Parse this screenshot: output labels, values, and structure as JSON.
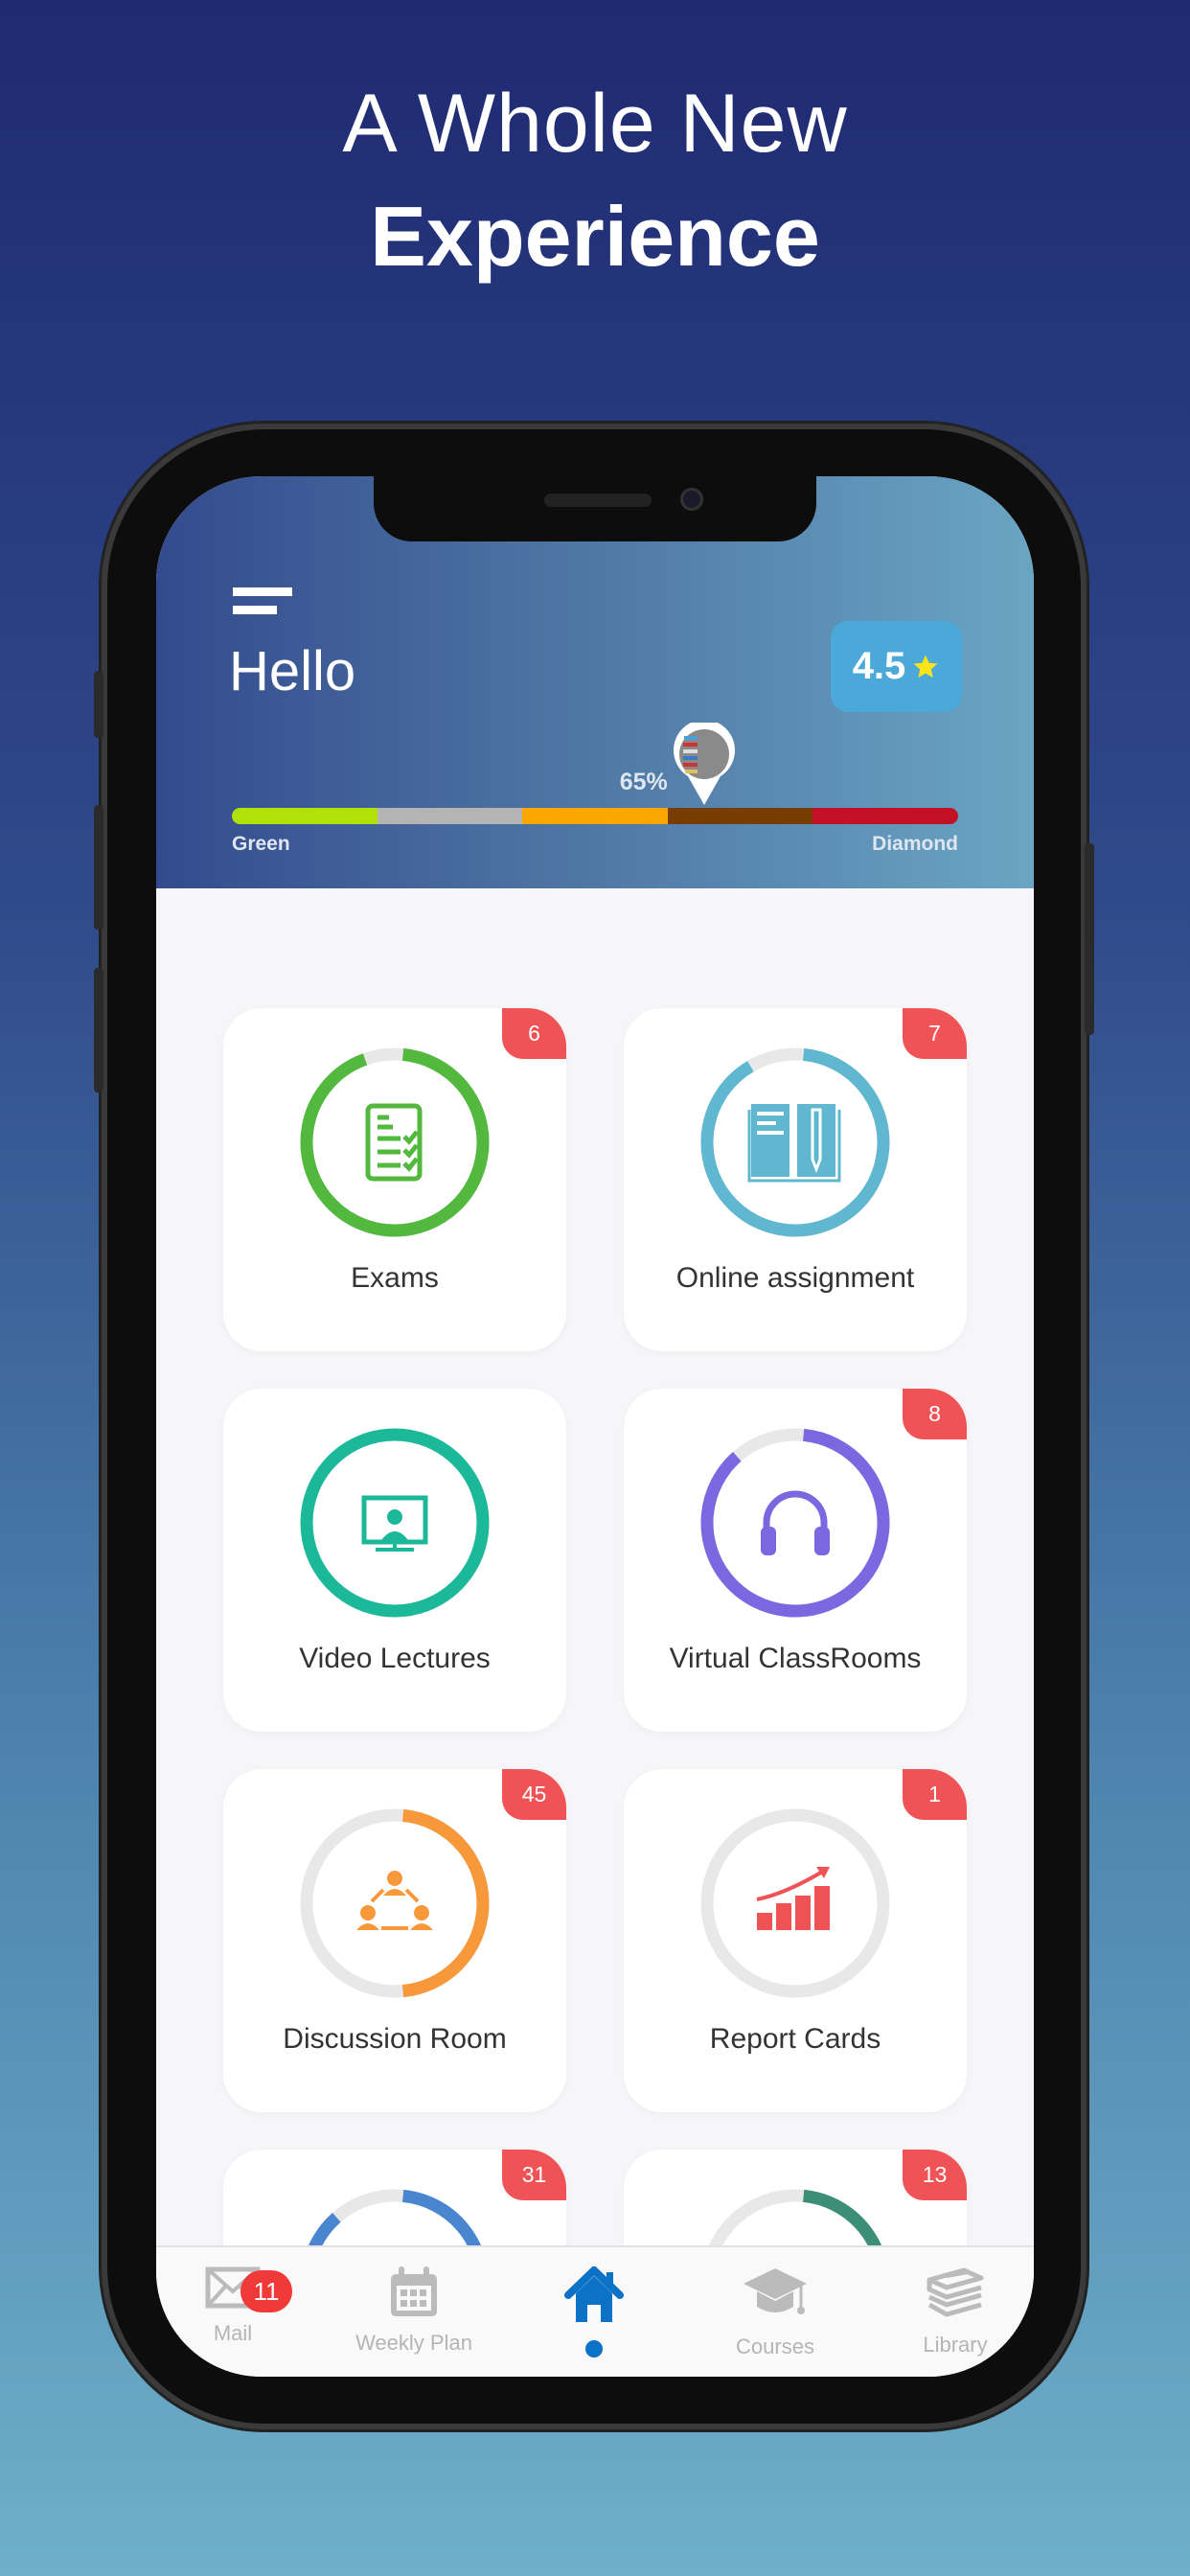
{
  "headline": {
    "line1": "A Whole New",
    "line2": "Experience"
  },
  "header": {
    "greeting": "Hello",
    "rating": "4.5",
    "rating_icon": "star-icon",
    "progress_label": "65%",
    "progress_value": 0.65,
    "levels": {
      "start": "Green",
      "end": "Diamond"
    },
    "level_colors": [
      "#b0e20a",
      "#b4b4b4",
      "#fca600",
      "#763c00",
      "#c21125"
    ]
  },
  "cards": [
    {
      "label": "Exams",
      "badge": "6",
      "color": "#52b83e",
      "progress": 0.96,
      "icon": "exam-checklist-icon"
    },
    {
      "label": "Online assignment",
      "badge": "7",
      "color": "#5fb8cf",
      "progress": 0.93,
      "icon": "book-pencil-icon"
    },
    {
      "label": "Video Lectures",
      "badge": "",
      "color": "#1bb99a",
      "progress": 1.0,
      "icon": "video-lecture-icon"
    },
    {
      "label": "Virtual ClassRooms",
      "badge": "8",
      "color": "#7b68e0",
      "progress": 0.9,
      "icon": "headphones-icon"
    },
    {
      "label": "Discussion Room",
      "badge": "45",
      "color": "#f7983a",
      "progress": 0.5,
      "icon": "group-discussion-icon"
    },
    {
      "label": "Report Cards",
      "badge": "1",
      "color": "#ef5356",
      "progress": 0.0,
      "icon": "growth-chart-icon"
    },
    {
      "label": "",
      "badge": "31",
      "color": "#4a86d0",
      "progress": 0.9,
      "icon": ""
    },
    {
      "label": "",
      "badge": "13",
      "color": "#3c8f76",
      "progress": 0.4,
      "icon": ""
    }
  ],
  "tabs": [
    {
      "label": "Mail",
      "icon": "mail-icon",
      "badge": "11"
    },
    {
      "label": "Weekly Plan",
      "icon": "calendar-icon"
    },
    {
      "label": "",
      "icon": "home-icon",
      "active": true
    },
    {
      "label": "Courses",
      "icon": "graduation-cap-icon"
    },
    {
      "label": "Library",
      "icon": "books-icon"
    }
  ],
  "colors": {
    "accent": "#0b72c6",
    "badge": "#ef5356"
  }
}
